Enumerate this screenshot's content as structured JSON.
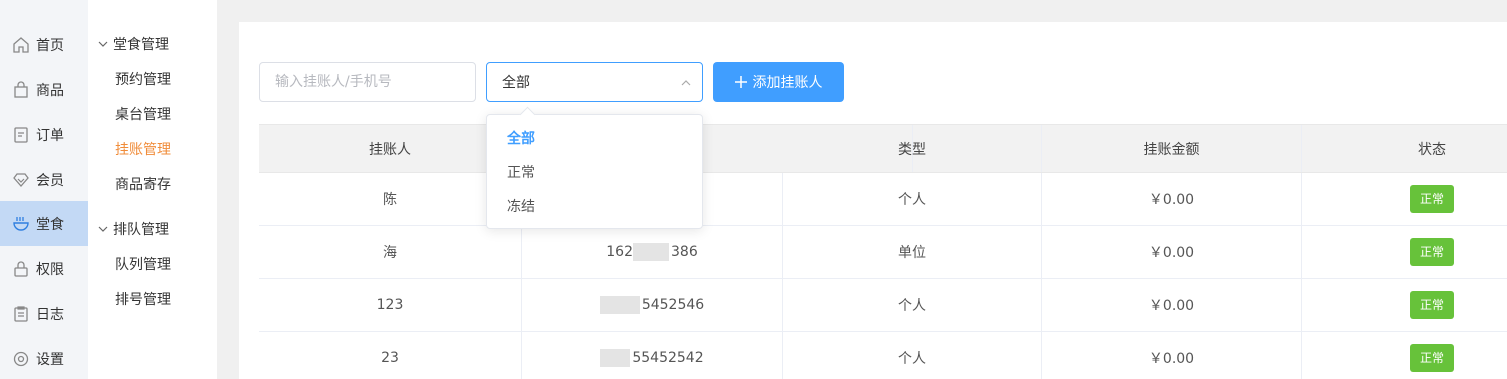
{
  "nav": {
    "items": [
      {
        "label": "首页",
        "icon": "home-icon"
      },
      {
        "label": "商品",
        "icon": "bag-icon"
      },
      {
        "label": "订单",
        "icon": "order-icon"
      },
      {
        "label": "会员",
        "icon": "diamond-icon"
      },
      {
        "label": "堂食",
        "icon": "bowl-icon"
      },
      {
        "label": "权限",
        "icon": "lock-icon"
      },
      {
        "label": "日志",
        "icon": "clipboard-icon"
      },
      {
        "label": "设置",
        "icon": "gear-icon"
      }
    ],
    "active_index": 4
  },
  "subnav": {
    "groups": [
      {
        "label": "堂食管理",
        "items": [
          "预约管理",
          "桌台管理",
          "挂账管理",
          "商品寄存"
        ]
      },
      {
        "label": "排队管理",
        "items": [
          "队列管理",
          "排号管理"
        ]
      }
    ],
    "active_item": "挂账管理"
  },
  "toolbar": {
    "search_placeholder": "输入挂账人/手机号",
    "select_value": "全部",
    "add_label": "添加挂账人"
  },
  "dropdown": {
    "options": [
      "全部",
      "正常",
      "冻结"
    ],
    "selected": "全部"
  },
  "table": {
    "headers": [
      "挂账人",
      "",
      "类型",
      "挂账金额",
      "状态"
    ],
    "rows": [
      {
        "name": "陈",
        "phone_prefix": "",
        "phone_suffix": "",
        "type": "个人",
        "amount": "￥0.00",
        "status": "正常"
      },
      {
        "name": "海",
        "phone_prefix": "162",
        "phone_suffix": "386",
        "type": "单位",
        "amount": "￥0.00",
        "status": "正常"
      },
      {
        "name": "123",
        "phone_prefix": "",
        "phone_suffix": "5452546",
        "type": "个人",
        "amount": "￥0.00",
        "status": "正常"
      },
      {
        "name": "23",
        "phone_prefix": "",
        "phone_suffix": "55452542",
        "type": "个人",
        "amount": "￥0.00",
        "status": "正常"
      }
    ]
  },
  "colors": {
    "primary": "#409eff",
    "success": "#67c23a",
    "active_sub": "#f08c3a",
    "active_nav_bg": "#c3d9f5"
  }
}
